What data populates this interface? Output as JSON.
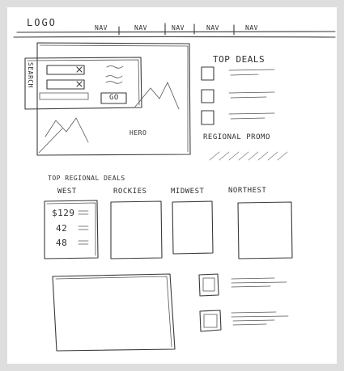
{
  "header": {
    "logo": "LOGO",
    "nav": [
      "NAV",
      "NAV",
      "NAV",
      "NAV",
      "NAV"
    ]
  },
  "search_panel": {
    "label": "SEARCH",
    "go_button": "GO"
  },
  "hero": {
    "label": "HERO"
  },
  "top_deals": {
    "title": "TOP DEALS",
    "items": 3
  },
  "regional_promo": {
    "label": "REGIONAL PROMO"
  },
  "regional_deals": {
    "title": "TOP REGIONAL DEALS",
    "columns": [
      "WEST",
      "ROCKIES",
      "MIDWEST",
      "NORTHEST"
    ],
    "west_prices": [
      "$129",
      "42",
      "48"
    ]
  }
}
